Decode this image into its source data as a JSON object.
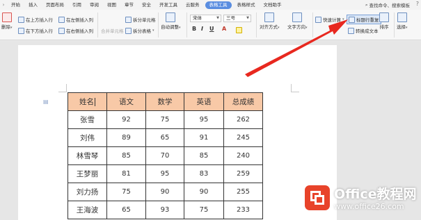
{
  "menu": {
    "items": [
      "开始",
      "插入",
      "页面布局",
      "引用",
      "审阅",
      "视图",
      "章节",
      "安全",
      "开发工具",
      "云服务",
      "表格工具",
      "表格样式",
      "文档助手"
    ],
    "active_index": 10,
    "search_label": "查找命令、搜索模板",
    "help": "?"
  },
  "ribbon": {
    "delete_label": "删除",
    "insert_above": "在上方插入行",
    "insert_below": "在下方插入行",
    "insert_left": "在左侧插入列",
    "insert_right": "在右侧插入列",
    "merge_cells": "合并单元格",
    "split_cells": "拆分单元格",
    "split_table": "拆分表格",
    "auto_fit": "自动调整",
    "font_name": "宋体",
    "font_size": "三号",
    "bold": "B",
    "italic": "I",
    "underline": "U",
    "font_color": "A",
    "align": "对齐方式",
    "text_direction": "文字方向",
    "quick_calc": "快速计算",
    "repeat_header": "标题行重复",
    "convert_text": "转换成文本",
    "sort": "排序",
    "select": "选择"
  },
  "table": {
    "headers": [
      "姓名",
      "语文",
      "数学",
      "英语",
      "总成绩"
    ],
    "rows": [
      [
        "张雪",
        "92",
        "75",
        "95",
        "262"
      ],
      [
        "刘伟",
        "89",
        "65",
        "91",
        "245"
      ],
      [
        "林雪琴",
        "85",
        "70",
        "85",
        "240"
      ],
      [
        "王梦丽",
        "81",
        "95",
        "83",
        "259"
      ],
      [
        "刘力扬",
        "75",
        "90",
        "90",
        "255"
      ],
      [
        "王海波",
        "65",
        "93",
        "75",
        "233"
      ]
    ]
  },
  "watermark": {
    "title": "Office教程网",
    "url": "www.office26.com"
  },
  "colors": {
    "header_fill": "#f8c9a7",
    "arrow": "#e8281f",
    "active_tab": "#5a8de0"
  }
}
